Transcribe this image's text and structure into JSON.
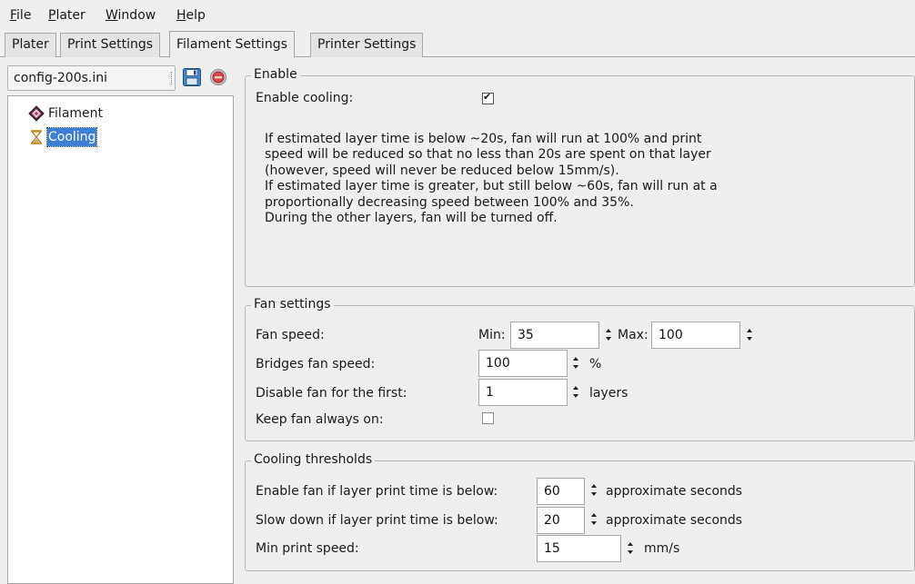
{
  "menu": {
    "file": {
      "u": "F",
      "rest": "ile"
    },
    "plater": {
      "u": "P",
      "rest": "later"
    },
    "window": {
      "u": "W",
      "rest": "indow"
    },
    "help": {
      "u": "H",
      "rest": "elp"
    }
  },
  "tabs": [
    "Plater",
    "Print Settings",
    "Filament Settings",
    "Printer Settings"
  ],
  "preset": {
    "value": "config-200s.ini"
  },
  "tree": {
    "items": [
      "Filament",
      "Cooling"
    ]
  },
  "enable": {
    "title": "Enable",
    "cooling_label": "Enable cooling:",
    "cooling_checked": true,
    "description": [
      "If estimated layer time is below ~20s, fan will run at 100% and print speed will be reduced so that no less than 20s are spent on that layer (however, speed will never be reduced below 15mm/s).",
      "If estimated layer time is greater, but still below ~60s, fan will run at a proportionally decreasing speed between 100% and 35%.",
      "During the other layers, fan will be turned off."
    ]
  },
  "fan": {
    "title": "Fan settings",
    "speed_label": "Fan speed:",
    "min_label": "Min:",
    "min_value": "35",
    "max_label": "Max:",
    "max_value": "100",
    "bridges_label": "Bridges fan speed:",
    "bridges_value": "100",
    "bridges_unit": "%",
    "disable_label": "Disable fan for the first:",
    "disable_value": "1",
    "disable_unit": "layers",
    "always_on_label": "Keep fan always on:",
    "always_on_checked": false
  },
  "thresholds": {
    "title": "Cooling thresholds",
    "enable_below_label": "Enable fan if layer print time is below:",
    "enable_below_value": "60",
    "enable_below_unit": "approximate seconds",
    "slowdown_label": "Slow down if layer print time is below:",
    "slowdown_value": "20",
    "slowdown_unit": "approximate seconds",
    "min_speed_label": "Min print speed:",
    "min_speed_value": "15",
    "min_speed_unit": "mm/s"
  },
  "colors": {
    "selection": "#3d7ed6",
    "background": "#efefef"
  }
}
